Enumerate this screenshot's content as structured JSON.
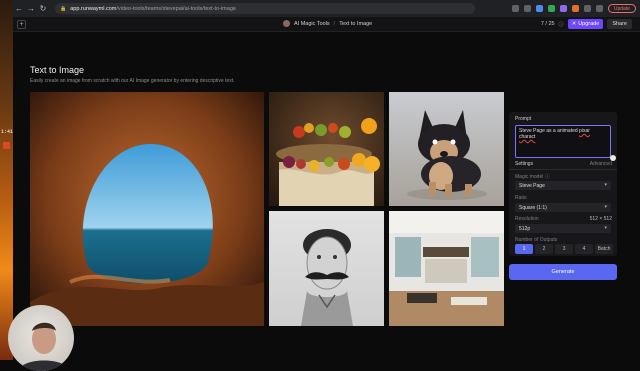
{
  "browser": {
    "url_host": "app.runwayml.com",
    "url_path": "/video-tools/teams/stevepai/ai-tools/text-to-image",
    "update_label": "Update"
  },
  "appbar": {
    "breadcrumb_parent": "AI Magic Tools",
    "breadcrumb_separator": "/",
    "breadcrumb_current": "Text to Image",
    "credits": "7 / 25",
    "upgrade_label": "Upgrade",
    "share_label": "Share"
  },
  "page": {
    "title": "Text to Image",
    "subtitle": "Easily create an image from scratch with our AI Image generator by entering descriptive text."
  },
  "wallpaper": {
    "label": "1:41"
  },
  "panel": {
    "prompt_label": "Prompt",
    "prompt_text_before": "Steve Page as a animated ",
    "prompt_text_misspelled_1": "pixar",
    "prompt_text_between": " ",
    "prompt_text_misspelled_2": "charact",
    "settings_label": "Settings",
    "advanced_label": "Advanced",
    "magic_model_label": "Magic model",
    "magic_model_value": "Steve Page",
    "ratio_label": "Ratio",
    "ratio_value": "Square (1:1)",
    "resolution_label": "Resolution",
    "resolution_size": "512 × 512",
    "resolution_value": "512p",
    "outputs_label": "Number of Outputs",
    "outputs": [
      "1",
      "2",
      "3",
      "4",
      "Batch"
    ],
    "selected_output": "1"
  },
  "generate_label": "Generate",
  "colors": {
    "accent": "#5a67f0",
    "upgrade": "#6c47ff",
    "background": "#0b0b0c"
  }
}
